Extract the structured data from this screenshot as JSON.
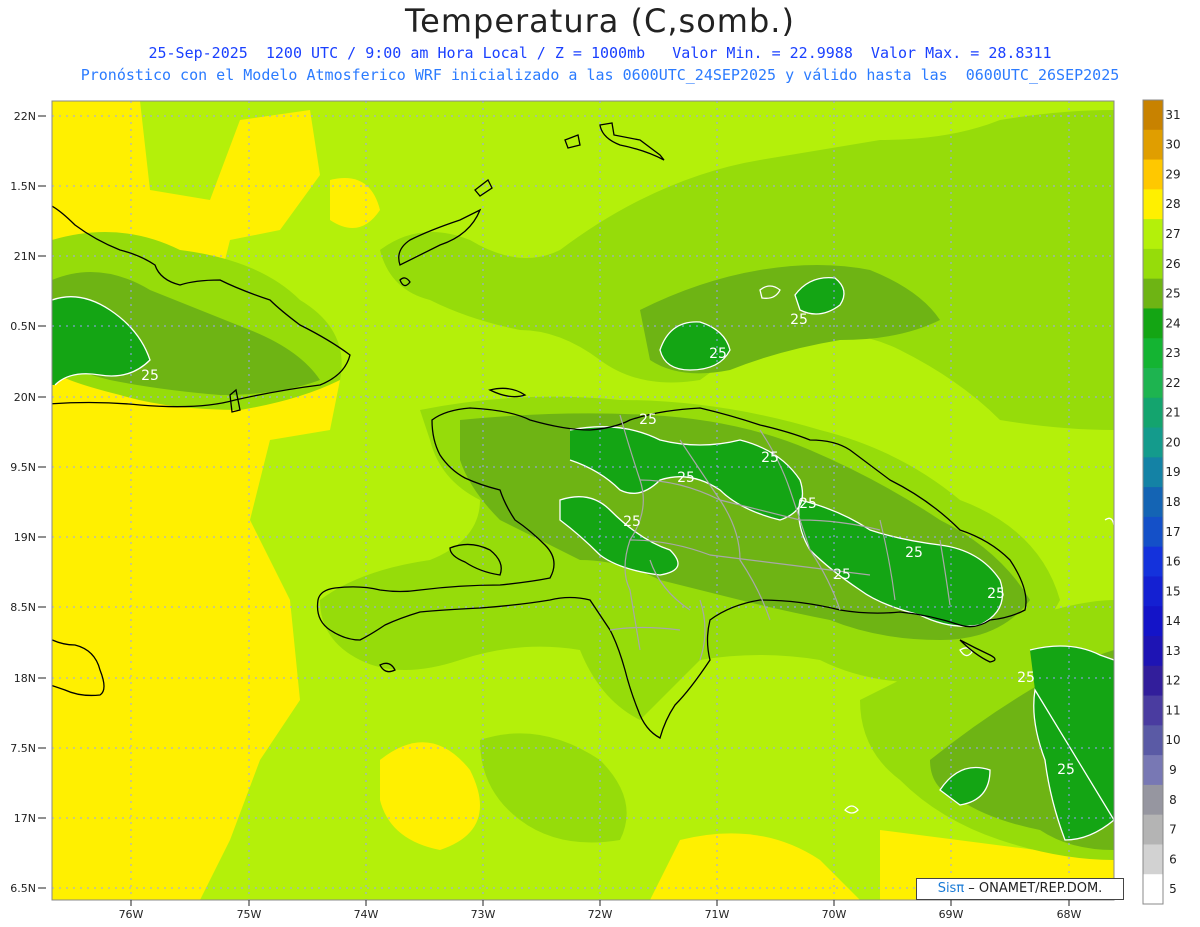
{
  "header": {
    "title": "Temperatura (C,somb.)",
    "line1": "25-Sep-2025  1200 UTC / 9:00 am Hora Local / Z = 1000mb   Valor Min. = 22.9988  Valor Max. = 28.8311",
    "line2": "Pronóstico con el Modelo Atmosferico WRF inicializado a las 0600UTC_24SEP2025 y válido hasta las  0600UTC_26SEP2025"
  },
  "axes": {
    "lat_labels": [
      "22N",
      "1.5N",
      "21N",
      "0.5N",
      "20N",
      "9.5N",
      "19N",
      "8.5N",
      "18N",
      "7.5N",
      "17N",
      "6.5N"
    ],
    "lon_labels": [
      "76W",
      "75W",
      "74W",
      "73W",
      "72W",
      "71W",
      "70W",
      "69W",
      "68W"
    ]
  },
  "colorbar": {
    "labels": [
      "31",
      "30",
      "29",
      "28",
      "27",
      "26",
      "25",
      "24",
      "23",
      "22",
      "21",
      "20",
      "19",
      "18",
      "17",
      "16",
      "15",
      "14",
      "13",
      "12",
      "11",
      "10",
      "9",
      "8",
      "7",
      "6",
      "5"
    ],
    "colors": [
      "#c88200",
      "#e09e00",
      "#ffc800",
      "#fff000",
      "#b4f00a",
      "#96dc0a",
      "#6eb414",
      "#14a514",
      "#14b432",
      "#1eb450",
      "#14a46e",
      "#149b8c",
      "#1482a5",
      "#1464b4",
      "#1450c8",
      "#1432dc",
      "#1420d2",
      "#1414c8",
      "#1e14b4",
      "#321e9b",
      "#4a3ca0",
      "#5a5aa5",
      "#7878b4",
      "#9696a0",
      "#b4b4b4",
      "#d2d2d2",
      "#ffffff"
    ]
  },
  "contour_label": "25",
  "palette": {
    "yellow": "#fff000",
    "light_green": "#b4f00a",
    "mid_green": "#96dc0a",
    "olive_green": "#6eb414",
    "dark_green": "#14a514"
  },
  "credit": {
    "brand": "Sisπ",
    "text": " – ONAMET/REP.DOM."
  }
}
